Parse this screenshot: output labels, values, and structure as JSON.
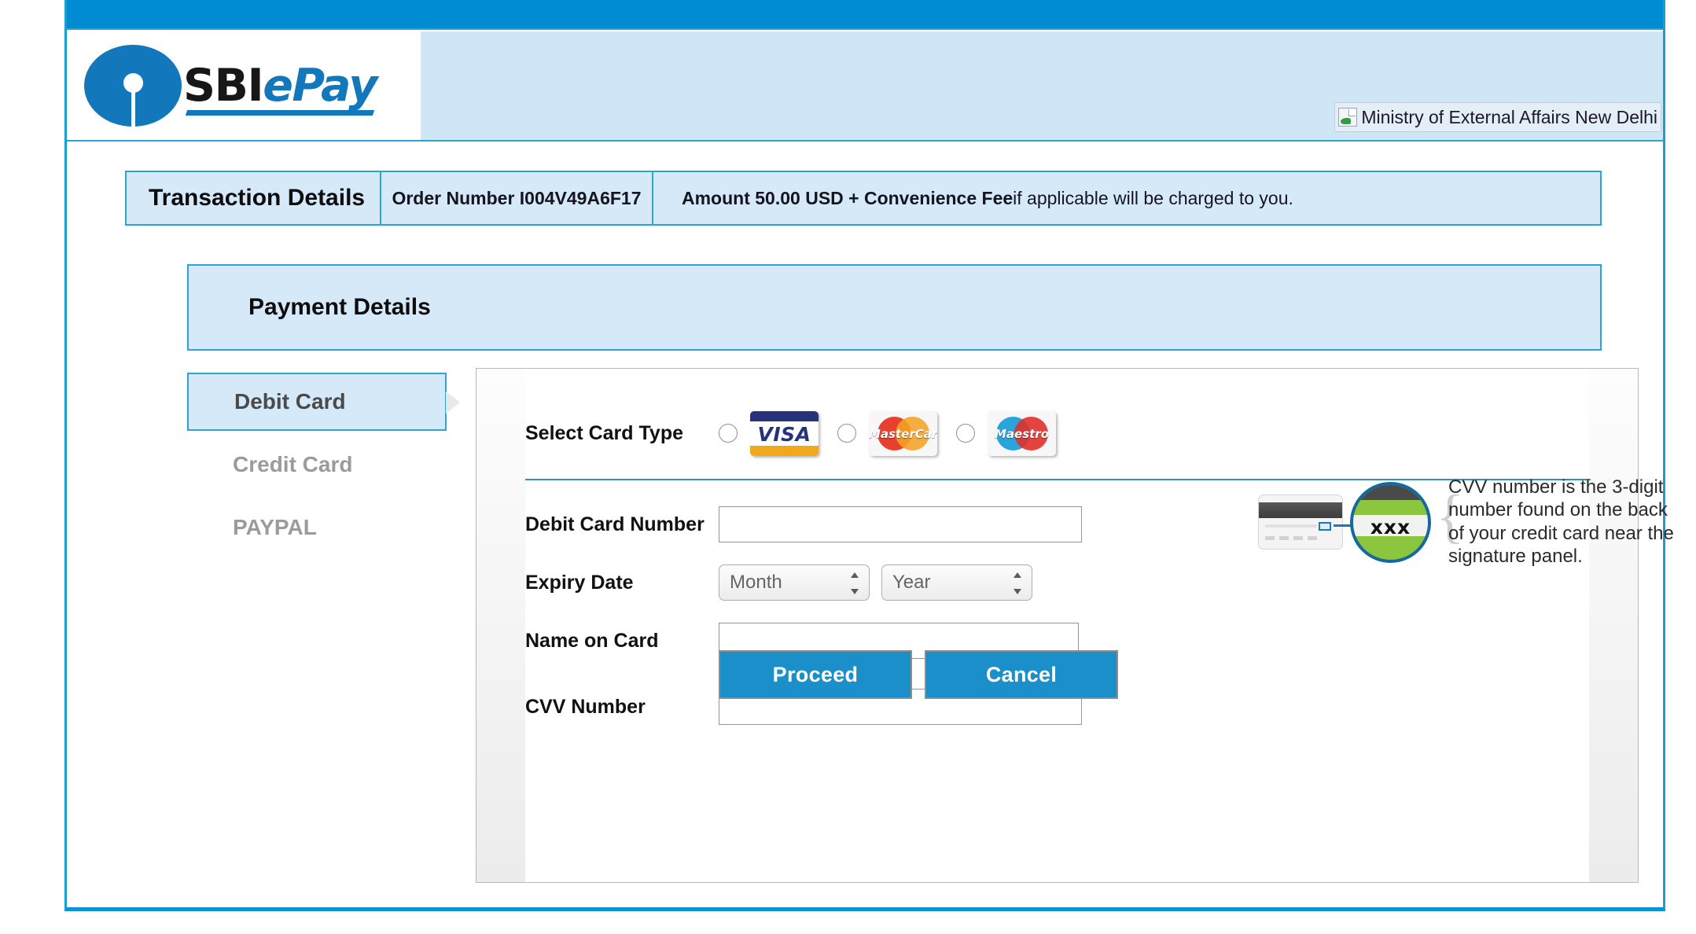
{
  "brand": {
    "logo_text_black": "SBI",
    "logo_text_e": "e",
    "logo_text_pay": "Pay"
  },
  "header": {
    "merchant_image_alt": "Ministry of External Affairs New Delhi"
  },
  "transaction": {
    "title": "Transaction Details",
    "order_label": "Order Number I004V49A6F17",
    "amount_bold": "Amount 50.00 USD + Convenience Fee",
    "amount_rest": " if applicable will be charged to you."
  },
  "payment": {
    "section_title": "Payment Details",
    "methods": [
      {
        "label": "Debit Card",
        "active": true
      },
      {
        "label": "Credit Card",
        "active": false
      },
      {
        "label": "PAYPAL",
        "active": false
      }
    ]
  },
  "form": {
    "card_type_label": "Select Card Type",
    "card_types": [
      {
        "name": "visa",
        "label": "VISA"
      },
      {
        "name": "mastercard",
        "label": "MasterCard"
      },
      {
        "name": "maestro",
        "label": "Maestro"
      }
    ],
    "card_number_label": "Debit Card Number",
    "card_number_value": "",
    "expiry_label": "Expiry Date",
    "month_placeholder": "Month",
    "year_placeholder": "Year",
    "name_label": "Name on Card",
    "name_value": "",
    "cvv_label": "CVV Number",
    "cvv_value": "",
    "cvv_art_digits": "xxx",
    "cvv_help": "CVV number is the 3-digit number found on the back of your credit card near the signature panel.",
    "proceed_label": "Proceed",
    "cancel_label": "Cancel"
  },
  "colors": {
    "topbar_blue": "#008bd2",
    "accent_teal": "#2da4d6",
    "panel_blue": "#d6e9f9",
    "header_blue": "#cfe6f7",
    "button_blue": "#1a8fc9"
  }
}
